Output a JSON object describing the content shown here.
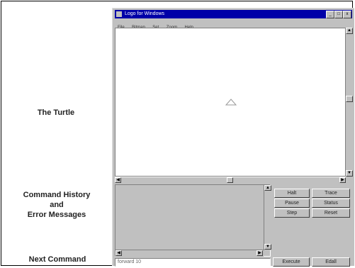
{
  "annotations": {
    "turtle": "The Turtle",
    "history_line1": "Command History",
    "history_line2": "and",
    "history_line3": "Error Messages",
    "next_command": "Next Command"
  },
  "window": {
    "title": "Logo for Windows",
    "minimize": "_",
    "maximize": "□",
    "close": "x",
    "menu": [
      "File",
      "Bitmap",
      "Set",
      "Zoom",
      "Help"
    ]
  },
  "buttons": {
    "halt": "Halt",
    "trace": "Trace",
    "pause": "Pause",
    "status": "Status",
    "step": "Step",
    "reset": "Reset",
    "execute": "Execute",
    "edall": "Edall"
  },
  "command_input": {
    "value": "forward 10"
  },
  "colors": {
    "titlebar": "#0000a8",
    "chrome": "#c0c0c0"
  }
}
